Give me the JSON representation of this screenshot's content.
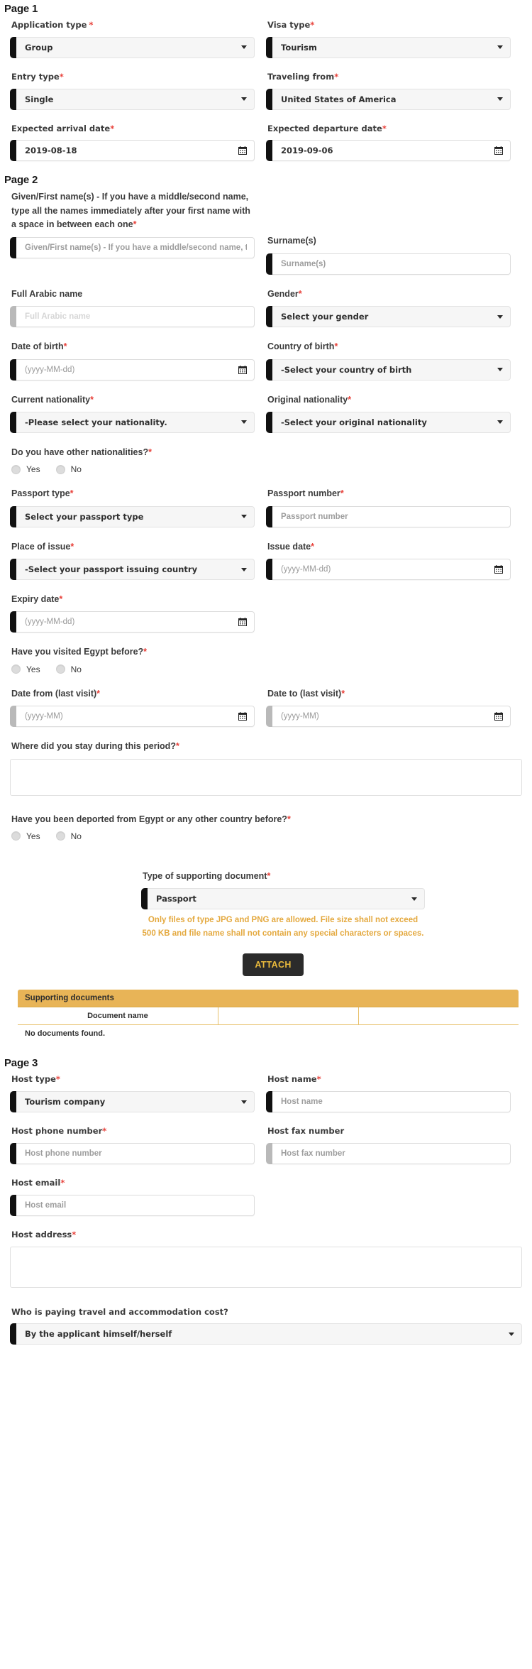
{
  "pages": {
    "page1_title": "Page 1",
    "page2_title": "Page 2",
    "page3_title": "Page 3"
  },
  "colors": {
    "required_star": "#e8413a",
    "accent_bar": "#111111",
    "accent_bar_optional": "#b9b9b9",
    "warning_text": "#e4a93f",
    "table_header": "#e8b457",
    "attach_button_bg": "#2b2b2b",
    "attach_button_text": "#e8b93c"
  },
  "page1": {
    "application_type": {
      "label": "Application type",
      "required": true,
      "value": "Group",
      "icon": "chevron-down-icon"
    },
    "visa_type": {
      "label": "Visa type",
      "required": true,
      "value": "Tourism",
      "icon": "chevron-down-icon"
    },
    "entry_type": {
      "label": "Entry type",
      "required": true,
      "value": "Single",
      "icon": "chevron-down-icon"
    },
    "traveling_from": {
      "label": "Traveling from",
      "required": true,
      "value": "United States of America",
      "icon": "chevron-down-icon"
    },
    "expected_arrival_date": {
      "label": "Expected arrival date",
      "required": true,
      "value": "2019-08-18",
      "icon": "calendar-icon"
    },
    "expected_departure_date": {
      "label": "Expected departure date",
      "required": true,
      "value": "2019-09-06",
      "icon": "calendar-icon"
    }
  },
  "page2": {
    "given_names": {
      "label": "Given/First name(s) - If you have a middle/second name, type all the names immediately after your first name with a space in between each one",
      "required": true,
      "placeholder": "Given/First name(s) - If you have a middle/second name, type all the names immediately after your first name with a space in between each one",
      "value": ""
    },
    "surnames": {
      "label": "Surname(s)",
      "required": false,
      "placeholder": "Surname(s)",
      "value": ""
    },
    "full_arabic_name": {
      "label": "Full Arabic name",
      "required": false,
      "placeholder": "Full Arabic name",
      "value": ""
    },
    "gender": {
      "label": "Gender",
      "required": true,
      "value": "Select your gender",
      "icon": "chevron-down-icon"
    },
    "date_of_birth": {
      "label": "Date of birth",
      "required": true,
      "placeholder": "(yyyy-MM-dd)",
      "value": "",
      "icon": "calendar-icon"
    },
    "country_of_birth": {
      "label": "Country of birth",
      "required": true,
      "value": "-Select your country of birth",
      "icon": "chevron-down-icon"
    },
    "current_nationality": {
      "label": "Current nationality",
      "required": true,
      "value": "-Please select your nationality.",
      "icon": "chevron-down-icon"
    },
    "original_nationality": {
      "label": "Original nationality",
      "required": true,
      "value": "-Select your original nationality",
      "icon": "chevron-down-icon"
    },
    "other_nationalities": {
      "label": "Do you have other nationalities?",
      "required": true,
      "options": [
        "Yes",
        "No"
      ],
      "selected": ""
    },
    "passport_type": {
      "label": "Passport type",
      "required": true,
      "value": "Select your passport type",
      "icon": "chevron-down-icon"
    },
    "passport_number": {
      "label": "Passport number",
      "required": true,
      "placeholder": "Passport number",
      "value": ""
    },
    "place_of_issue": {
      "label": "Place of issue",
      "required": true,
      "value": "-Select your passport issuing country",
      "icon": "chevron-down-icon"
    },
    "issue_date": {
      "label": "Issue date",
      "required": true,
      "placeholder": "(yyyy-MM-dd)",
      "value": "",
      "icon": "calendar-icon"
    },
    "expiry_date": {
      "label": "Expiry date",
      "required": true,
      "placeholder": "(yyyy-MM-dd)",
      "value": "",
      "icon": "calendar-icon"
    },
    "visited_egypt_before": {
      "label": "Have you visited Egypt before?",
      "required": true,
      "options": [
        "Yes",
        "No"
      ],
      "selected": ""
    },
    "date_from_last_visit": {
      "label": "Date from (last visit)",
      "required": true,
      "placeholder": "(yyyy-MM)",
      "value": "",
      "icon": "calendar-icon"
    },
    "date_to_last_visit": {
      "label": "Date to (last visit)",
      "required": true,
      "placeholder": "(yyyy-MM)",
      "value": "",
      "icon": "calendar-icon"
    },
    "where_did_you_stay": {
      "label": "Where did you stay during this period?",
      "required": true,
      "value": ""
    },
    "deported_before": {
      "label": "Have you been deported from Egypt or any other country before?",
      "required": true,
      "options": [
        "Yes",
        "No"
      ],
      "selected": ""
    },
    "supporting_document_type": {
      "label": "Type of supporting document",
      "required": true,
      "value": "Passport",
      "icon": "chevron-down-icon"
    },
    "file_note": "Only files of type JPG and PNG are allowed. File size shall not exceed 500 KB and file name shall not contain any special characters or spaces.",
    "attach_button": "ATTACH",
    "documents_table": {
      "caption": "Supporting documents",
      "columns": [
        "",
        "Document name",
        "",
        ""
      ],
      "empty_message": "No documents found.",
      "rows": []
    }
  },
  "page3": {
    "host_type": {
      "label": "Host type",
      "required": true,
      "value": "Tourism company",
      "icon": "chevron-down-icon"
    },
    "host_name": {
      "label": "Host name",
      "required": true,
      "placeholder": "Host name",
      "value": ""
    },
    "host_phone_number": {
      "label": "Host phone number",
      "required": true,
      "placeholder": "Host phone number",
      "value": ""
    },
    "host_fax_number": {
      "label": "Host fax number",
      "required": false,
      "placeholder": "Host fax number",
      "value": ""
    },
    "host_email": {
      "label": "Host email",
      "required": true,
      "placeholder": "Host email",
      "value": ""
    },
    "host_address": {
      "label": "Host address",
      "required": true,
      "value": ""
    },
    "paying_cost": {
      "label": "Who is paying travel and accommodation cost?",
      "required": false,
      "value": "By the applicant himself/herself",
      "icon": "chevron-down-icon"
    }
  }
}
